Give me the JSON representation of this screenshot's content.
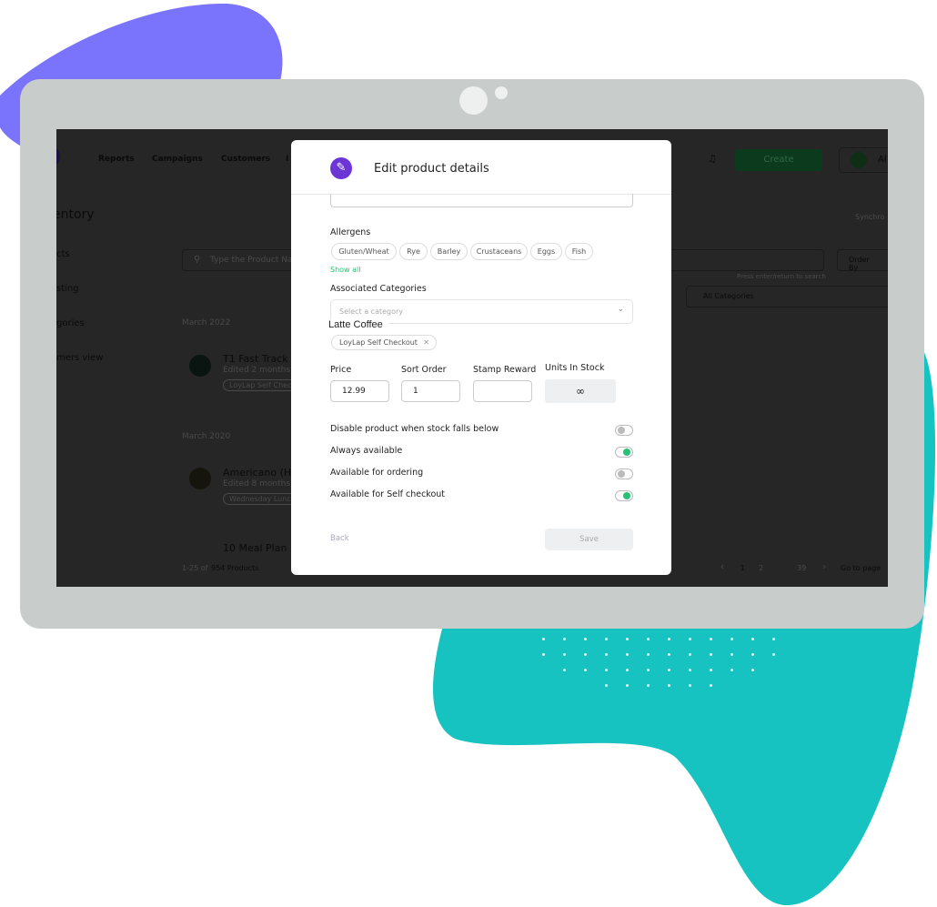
{
  "colors": {
    "purple_blob": "#7a73fb",
    "teal_blob": "#17c3c1",
    "tablet_frame": "#c8cccb",
    "accent_green": "#27c078",
    "brand_purple": "#6c35d6"
  },
  "app": {
    "nav": [
      "Reports",
      "Campaigns",
      "Customers",
      "I"
    ],
    "create_label": "Create",
    "account_label": "Al",
    "page_title": "entory",
    "sync_label": "Synchro",
    "sidebar": [
      "cts",
      "sting",
      "gories",
      "mers view"
    ],
    "search_placeholder": "Type the Product Na",
    "search_hint": "Press enter/return to search",
    "order_by": "Order By",
    "all_categories": "All Categories",
    "groups": [
      {
        "date": "March 2022",
        "name": "T1 Fast Track",
        "edited": "Edited 2 months",
        "tag": "LoyLap Self Check"
      },
      {
        "date": "March 2020",
        "name": "Americano (Ho",
        "edited": "Edited 8 months",
        "tag": "Wednesday Lunch"
      }
    ],
    "third_item": "10 Meal Plan",
    "count_prefix": "1-25 of",
    "count": "954 Products",
    "pages": [
      "1",
      "2",
      "39"
    ],
    "goto": "Go to page"
  },
  "modal": {
    "title": "Edit product details",
    "allergens_label": "Allergens",
    "allergens": [
      "Gluten/Wheat",
      "Rye",
      "Barley",
      "Crustaceans",
      "Eggs",
      "Fish"
    ],
    "show_all": "Show all",
    "categories_label": "Associated Categories",
    "category_placeholder": "Select a category",
    "latte_label": "Latte Coffee",
    "selected_category": "LoyLap Self Checkout",
    "fields": {
      "price_label": "Price",
      "price": "12.99",
      "sort_label": "Sort Order",
      "sort": "1",
      "stamp_label": "Stamp Reward",
      "stamp": "",
      "units_label": "Units In Stock",
      "units": "∞"
    },
    "toggles": [
      {
        "label": "Disable product when stock falls below",
        "on": false
      },
      {
        "label": "Always available",
        "on": true
      },
      {
        "label": "Available for ordering",
        "on": false
      },
      {
        "label": "Available for Self checkout",
        "on": true
      }
    ],
    "back": "Back",
    "save": "Save"
  }
}
